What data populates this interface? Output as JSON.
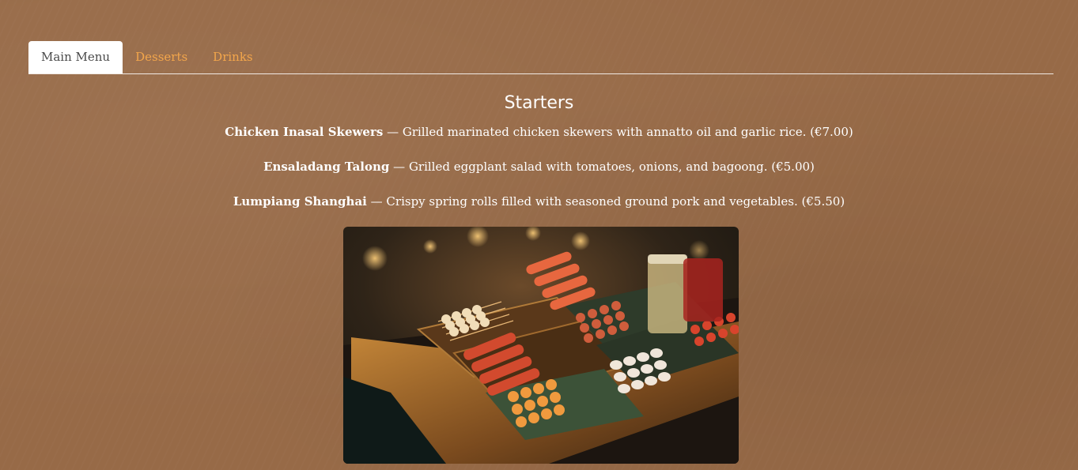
{
  "tabs": [
    {
      "label": "Main Menu",
      "active": true
    },
    {
      "label": "Desserts",
      "active": false
    },
    {
      "label": "Drinks",
      "active": false
    }
  ],
  "section": {
    "title": "Starters"
  },
  "items": [
    {
      "name": "Chicken Inasal Skewers",
      "separator": " — ",
      "description": "Grilled marinated chicken skewers with annatto oil and garlic rice. (€7.00)"
    },
    {
      "name": "Ensaladang Talong",
      "separator": " — ",
      "description": "Grilled eggplant salad with tomatoes, onions, and bagoong. (€5.00)"
    },
    {
      "name": "Lumpiang Shanghai",
      "separator": " — ",
      "description": "Crispy spring rolls filled with seasoned ground pork and vegetables. (€5.50)"
    }
  ],
  "colors": {
    "background": "#976a47",
    "tab_inactive": "#f3a64b",
    "tab_active_bg": "#ffffff",
    "text": "#ffffff"
  }
}
